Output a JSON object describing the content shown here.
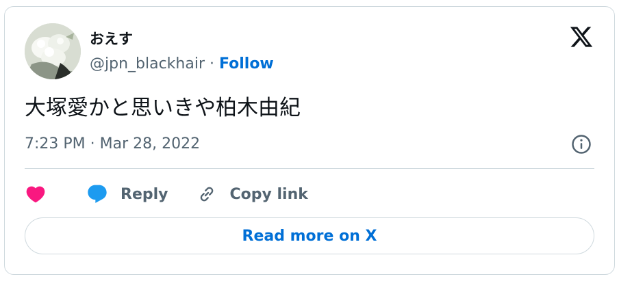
{
  "author": {
    "display_name": "おえす",
    "handle": "@jpn_blackhair",
    "separator": " · ",
    "follow_label": "Follow"
  },
  "tweet": {
    "text": "大塚愛かと思いきや柏木由紀",
    "timestamp": "7:23 PM · Mar 28, 2022"
  },
  "actions": {
    "reply_label": "Reply",
    "copy_link_label": "Copy link"
  },
  "footer": {
    "read_more_label": "Read more on X"
  },
  "icons": {
    "logo": "x-logo-icon",
    "info": "info-icon",
    "like": "heart-icon",
    "reply": "speech-bubble-icon",
    "copy_link": "link-icon"
  },
  "colors": {
    "like": "#f91880",
    "reply": "#1d9bf0",
    "link_blue": "#006fd6",
    "secondary_text": "#536471",
    "border": "#cfd9de"
  }
}
